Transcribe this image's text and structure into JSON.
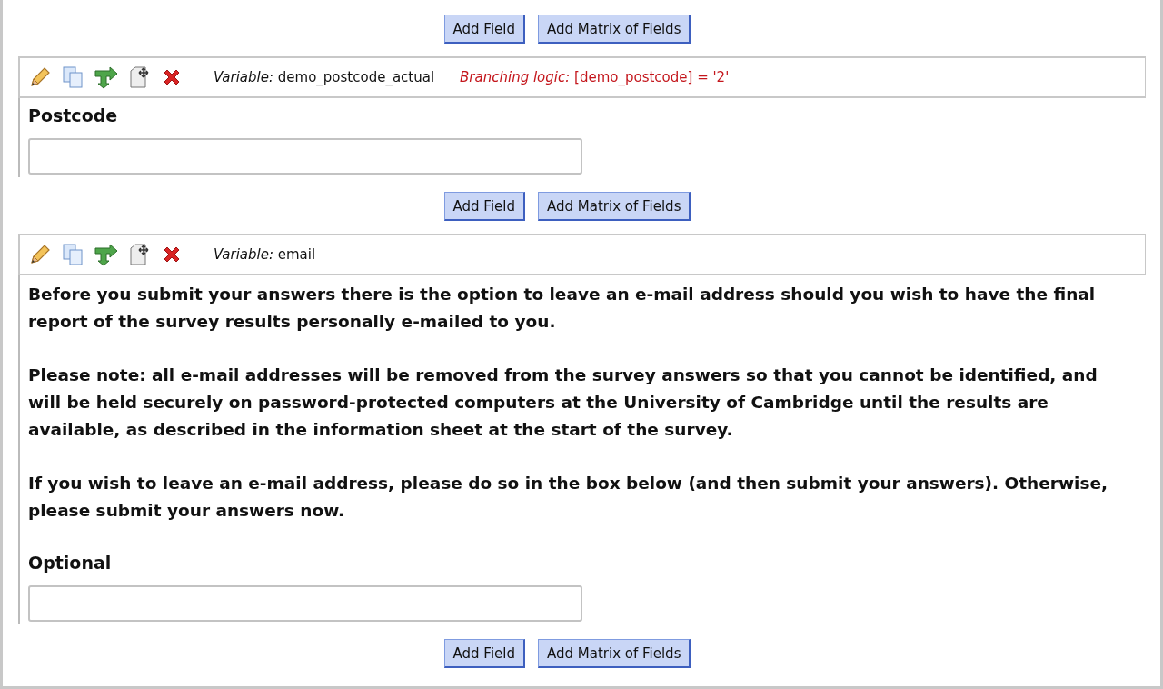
{
  "sections": [
    {
      "kind": "add_buttons",
      "buttons": [
        "Add Field",
        "Add Matrix of Fields"
      ]
    },
    {
      "kind": "field",
      "variable_label": "Variable:",
      "variable": "demo_postcode_actual",
      "branching_label": "Branching logic:",
      "branching": "[demo_postcode] = '2'",
      "label": "Postcode"
    },
    {
      "kind": "add_buttons",
      "buttons": [
        "Add Field",
        "Add Matrix of Fields"
      ]
    },
    {
      "kind": "field",
      "variable_label": "Variable:",
      "variable": "email",
      "paragraphs": [
        "Before you submit your answers there is the option to leave an e-mail address should you wish to have the final report of the survey results personally e-mailed to you.",
        "Please note: all e-mail addresses will be removed from the survey answers so that you cannot be identified, and will be held securely on password-protected computers at the University of Cambridge until the results are available, as described in the information sheet at the start of the survey.",
        "If you wish to leave an e-mail address, please do so in the box below (and then submit your answers). Otherwise, please submit your answers now."
      ],
      "label": "Optional"
    },
    {
      "kind": "add_buttons",
      "buttons": [
        "Add Field",
        "Add Matrix of Fields"
      ]
    }
  ]
}
